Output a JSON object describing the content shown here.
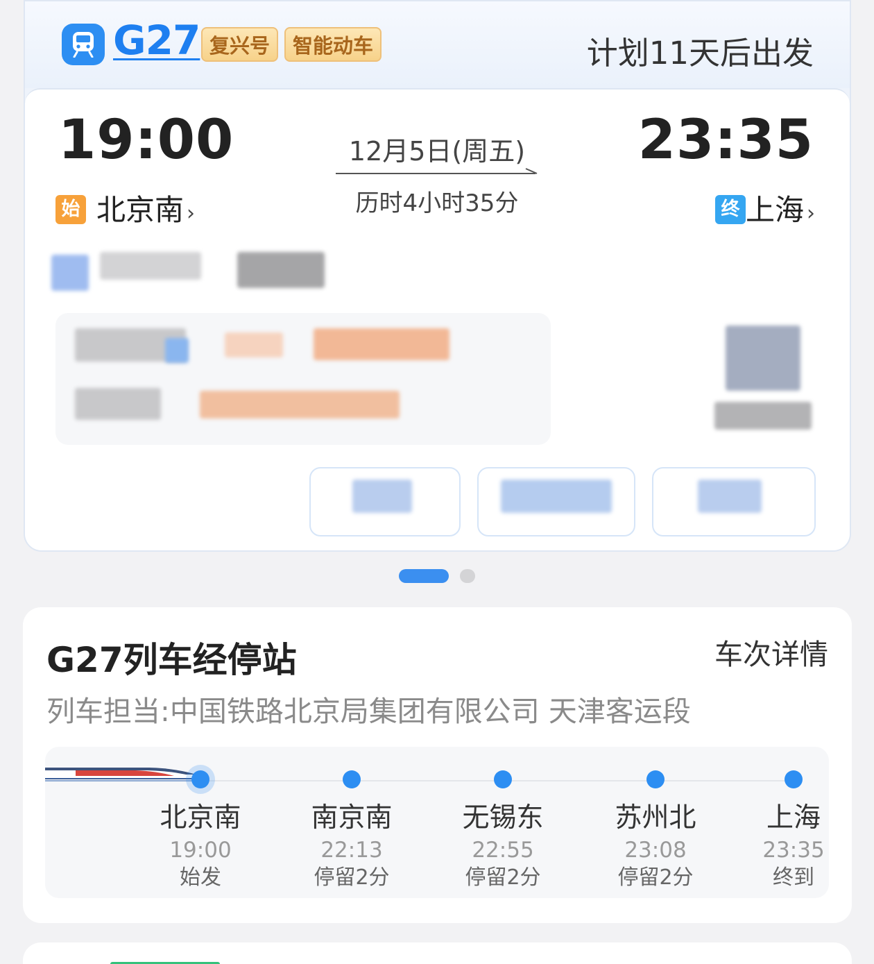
{
  "header": {
    "train_code": "G27",
    "badges": [
      "复兴号",
      "智能动车"
    ],
    "depart_plan": "计划11天后出发"
  },
  "journey": {
    "departure_time": "19:00",
    "arrival_time": "23:35",
    "date": "12月5日(周五)",
    "duration": "历时4小时35分",
    "start_tag": "始",
    "end_tag": "终",
    "from_station": "北京南",
    "to_station": "上海",
    "chevron": "›"
  },
  "pager": {
    "total": 2,
    "active": 1
  },
  "stops_section": {
    "title": "G27列车经停站",
    "detail_link": "车次详情",
    "operator": "列车担当:中国铁路北京局集团有限公司 天津客运段",
    "stops": [
      {
        "name": "北京南",
        "time": "19:00",
        "note": "始发"
      },
      {
        "name": "南京南",
        "time": "22:13",
        "note": "停留2分"
      },
      {
        "name": "无锡东",
        "time": "22:55",
        "note": "停留2分"
      },
      {
        "name": "苏州北",
        "time": "23:08",
        "note": "停留2分"
      },
      {
        "name": "上海",
        "time": "23:35",
        "note": "终到"
      }
    ]
  },
  "colors": {
    "accent": "#2d8ef2",
    "badge_text": "#a8661c",
    "start_tag": "#f7a13a",
    "end_tag": "#35a6f1"
  },
  "icons": [
    "train-icon",
    "route-arrow-icon",
    "chevron-right-icon",
    "train-graphic-icon"
  ]
}
